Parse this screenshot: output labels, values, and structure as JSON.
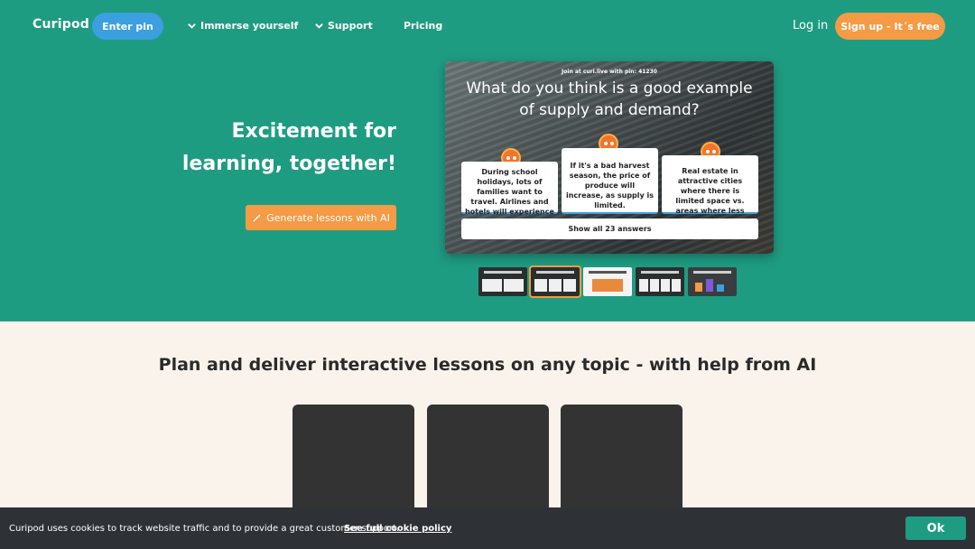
{
  "nav": {
    "logo": "Curipod",
    "enter_pin": "Enter pin",
    "immerse": "Immerse yourself",
    "support": "Support",
    "pricing": "Pricing",
    "login": "Log in",
    "signup": "Sign up - It´s free"
  },
  "hero": {
    "headline_line1": "Excitement for",
    "headline_line2": "learning, together!",
    "generate_button": "Generate lessons with AI"
  },
  "slide": {
    "join_text": "Join at curi.live with pin: 41230",
    "question": "What do you think is a good example of supply and demand?",
    "answers": [
      "During school holidays, lots of families want to travel. Airlines and hotels will experience ...",
      "If it's a bad harvest season, the price of produce will increase, as supply is limited.",
      "Real estate in attractive cities where there is limited space vs. areas where less people ..."
    ],
    "show_all": "Show all 23 answers"
  },
  "section": {
    "title": "Plan and deliver interactive lessons on any topic - with help from AI"
  },
  "cookie": {
    "text": "Curipod uses cookies to track website traffic and to provide a great customer support.",
    "link": "See full cookie policy",
    "ok": "Ok"
  },
  "colors": {
    "hero_bg": "#1e9c82",
    "accent_orange": "#f59a45",
    "accent_blue": "#3b9fe0",
    "page_bg": "#faf3ec"
  }
}
